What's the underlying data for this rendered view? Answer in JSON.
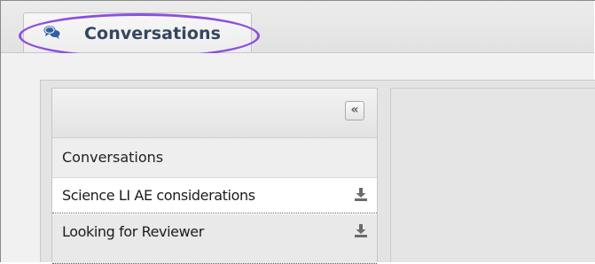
{
  "tab": {
    "label": "Conversations",
    "icon": "chat-bubbles-icon"
  },
  "sidebar": {
    "collapse_label": "«",
    "title": "Conversations",
    "items": [
      {
        "label": "Science LI AE considerations",
        "icon": "download-icon"
      },
      {
        "label": "Looking for Reviewer",
        "icon": "download-icon"
      }
    ]
  },
  "colors": {
    "highlight": "#8c50dd",
    "tab_text": "#33475f",
    "icon": "#2f5fa5"
  }
}
